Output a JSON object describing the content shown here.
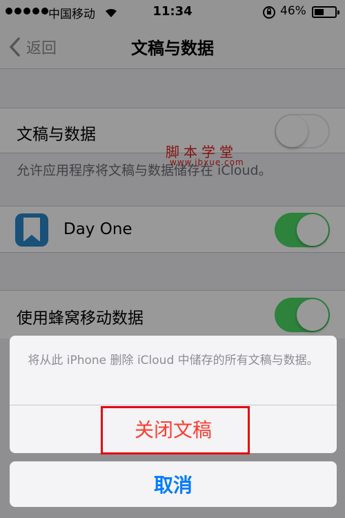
{
  "status_bar": {
    "carrier": "中国移动",
    "time": "11:34",
    "battery_percent": "46%",
    "battery_level": 0.46,
    "signal_bars": 5
  },
  "nav": {
    "back_label": "返回",
    "title": "文稿与数据"
  },
  "settings": {
    "docs_data_label": "文稿与数据",
    "docs_data_enabled": false,
    "footer": "允许应用程序将文稿与数据储存在 iCloud。",
    "app_name": "Day One",
    "app_enabled": true,
    "cellular_label": "使用蜂窝移动数据",
    "cellular_enabled": true
  },
  "watermark": {
    "text": "脚本学堂",
    "url": "www.jbxue.com"
  },
  "action_sheet": {
    "message": "将从此 iPhone 删除 iCloud 中储存的所有文稿与数据。",
    "destructive_label": "关闭文稿",
    "cancel_label": "取消"
  },
  "colors": {
    "toggle_on": "#4cd964",
    "destructive": "#ff3b30",
    "cancel": "#007aff",
    "highlight": "#e60012"
  }
}
